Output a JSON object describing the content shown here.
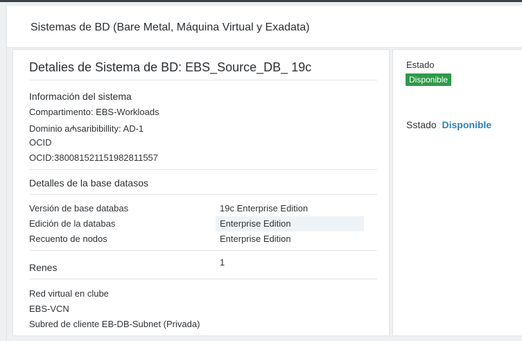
{
  "page": {
    "header_title": "Sistemas de BD (Bare Metal, Máquina Virtual y Exadata)"
  },
  "details": {
    "title": "Detalies de Sistema de BD: EBS_Source_DB_ 19c",
    "system_info": {
      "heading": "Información del sistema",
      "compartment": "Compartimento: EBS-Workloads",
      "domain": "Dominio a₼saribibillity: AD-1",
      "ocid_label": "OCID",
      "ocid_value": "OCID:380081521151982811557"
    },
    "db_section": {
      "heading": "Detalles de la base datasos",
      "rows": [
        {
          "key": "Versión de base databas",
          "value": "19c Enterprise Edition"
        },
        {
          "key": "Edición de la databas",
          "value": "Enterprise Edition"
        },
        {
          "key": "Recuento de nodos",
          "value": "Enterprise Edition"
        }
      ]
    },
    "network": {
      "heading": "Renes",
      "count": "1",
      "vcn_label": "Red virtual en clube",
      "vcn_value": "EBS-VCN",
      "subnet": "Subred de cliente EB-DB-Subnet (Privada)"
    }
  },
  "status_panel": {
    "label": "Estado",
    "badge": "Disponible",
    "state_label": "Sstado",
    "state_sep": ":",
    "state_value": "Disponible"
  },
  "colors": {
    "badge_green": "#2e9a4a",
    "link_blue": "#2f7fb8",
    "page_bg": "#eef0f2"
  }
}
